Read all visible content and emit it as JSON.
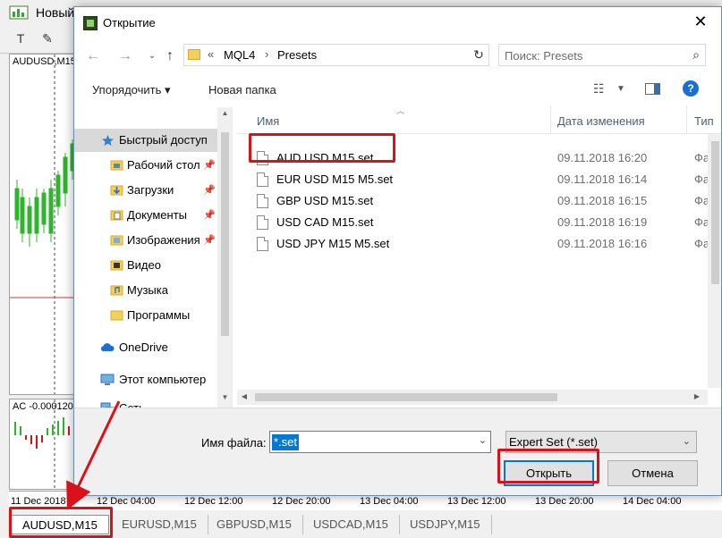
{
  "terminal": {
    "app_title": "Новый",
    "chart_label": "AUDUSD,M15",
    "indicator_label": "AC -0.000120",
    "time_ticks": [
      "11 Dec 2018",
      "12 Dec 04:00",
      "12 Dec 12:00",
      "12 Dec 20:00",
      "13 Dec 04:00",
      "13 Dec 12:00",
      "13 Dec 20:00",
      "14 Dec 04:00"
    ],
    "symbol_tabs": [
      "AUDUSD,M15",
      "EURUSD,M15",
      "GBPUSD,M15",
      "USDCAD,M15",
      "USDJPY,M15"
    ],
    "active_tab": "AUDUSD,M15"
  },
  "dialog": {
    "title": "Открытие",
    "close_glyph": "✕",
    "address": {
      "chevron": "«",
      "segment1": "MQL4",
      "separator": "›",
      "segment2": "Presets"
    },
    "search": {
      "placeholder": "Поиск: Presets"
    },
    "commands": {
      "organize": "Упорядочить ▾",
      "new_folder": "Новая папка"
    },
    "nav": {
      "items": [
        {
          "label": "Быстрый доступ",
          "icon": "star-icon",
          "pinned": false
        },
        {
          "label": "Рабочий стол",
          "icon": "desktop-folder-icon",
          "pinned": true
        },
        {
          "label": "Загрузки",
          "icon": "downloads-folder-icon",
          "pinned": true
        },
        {
          "label": "Документы",
          "icon": "documents-folder-icon",
          "pinned": true
        },
        {
          "label": "Изображения",
          "icon": "pictures-folder-icon",
          "pinned": true
        },
        {
          "label": "Видео",
          "icon": "video-folder-icon",
          "pinned": false
        },
        {
          "label": "Музыка",
          "icon": "music-folder-icon",
          "pinned": false
        },
        {
          "label": "Программы",
          "icon": "folder-icon",
          "pinned": false
        },
        {
          "label": "OneDrive",
          "icon": "cloud-icon",
          "pinned": false
        },
        {
          "label": "Этот компьютер",
          "icon": "computer-icon",
          "pinned": false
        },
        {
          "label": "Сеть",
          "icon": "network-icon",
          "pinned": false
        }
      ]
    },
    "list": {
      "columns": {
        "name": "Имя",
        "date": "Дата изменения",
        "type": "Тип"
      },
      "files": [
        {
          "name": "AUD USD M15.set",
          "date": "09.11.2018 16:20",
          "type": "Фай"
        },
        {
          "name": "EUR USD M15 M5.set",
          "date": "09.11.2018 16:14",
          "type": "Фай"
        },
        {
          "name": "GBP USD M15.set",
          "date": "09.11.2018 16:15",
          "type": "Фай"
        },
        {
          "name": "USD CAD M15.set",
          "date": "09.11.2018 16:19",
          "type": "Фай"
        },
        {
          "name": "USD JPY M15 M5.set",
          "date": "09.11.2018 16:16",
          "type": "Фай"
        }
      ]
    },
    "bottom": {
      "filename_label": "Имя файла:",
      "filename_value": "*.set",
      "filter_value": "Expert Set (*.set)",
      "open_label": "Открыть",
      "cancel_label": "Отмена"
    }
  },
  "colors": {
    "highlight": "#d9121a",
    "accent": "#0078d7",
    "bull_candle": "#2db52d"
  }
}
